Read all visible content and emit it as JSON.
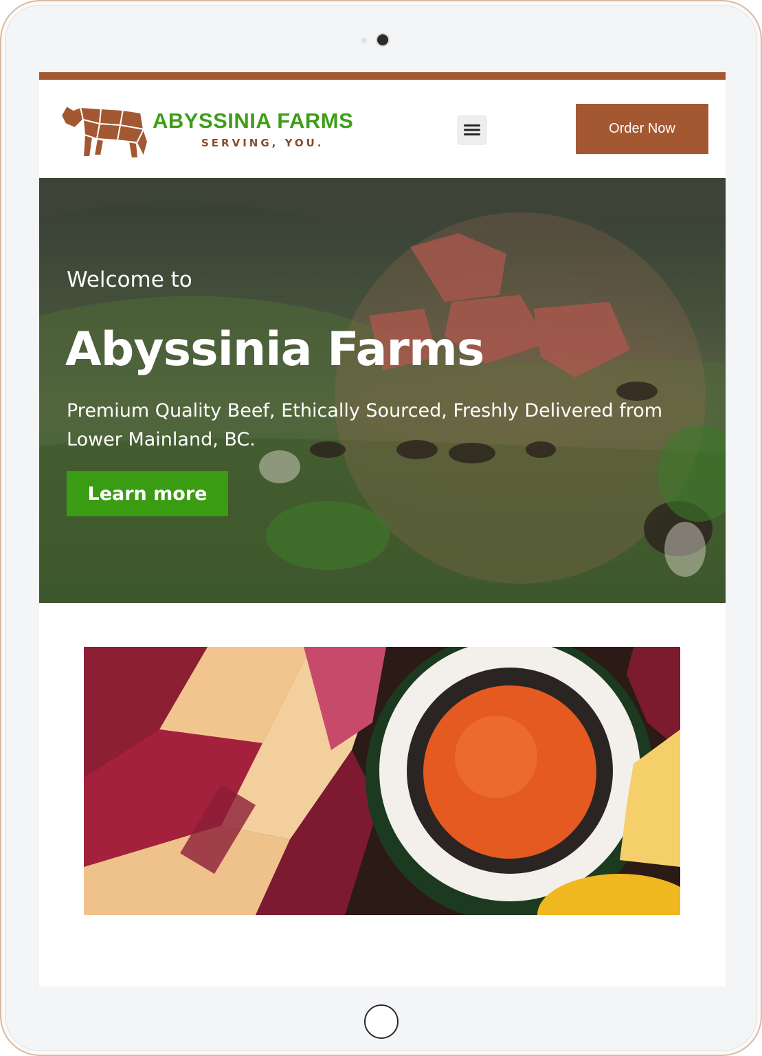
{
  "header": {
    "brand_name": "ABYSSINIA FARMS",
    "tagline": "SERVING, YOU.",
    "order_button_label": "Order Now"
  },
  "hero": {
    "welcome": "Welcome to",
    "title": "Abyssinia Farms",
    "subtitle": "Premium Quality Beef, Ethically Sourced, Freshly Delivered from Lower Mainland, BC.",
    "cta_label": "Learn more"
  },
  "colors": {
    "brand_brown": "#a35832",
    "brand_green": "#3d9e17",
    "cta_green": "#3a9c13",
    "device_frame": "#f4f5f7"
  },
  "icons": {
    "logo": "cow-icon",
    "menu": "hamburger-menu-icon"
  }
}
